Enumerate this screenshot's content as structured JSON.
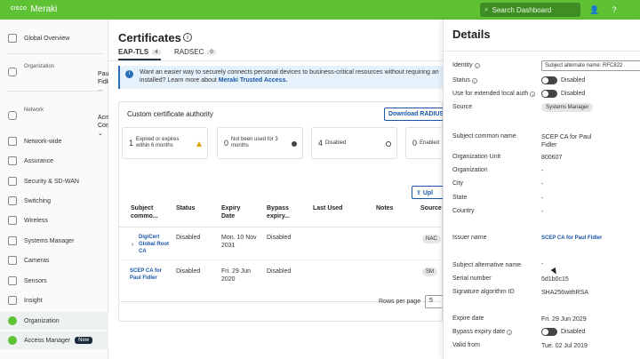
{
  "topbar": {
    "logo_company": "CISCO",
    "brand": "Meraki",
    "search_placeholder": "Search Dashboard",
    "icons": [
      "user-icon",
      "help-icon"
    ]
  },
  "sidebar": {
    "items": [
      {
        "label": "Global Overview",
        "icon": "globe-icon"
      },
      {
        "label": "Network-wide",
        "icon": "network-icon"
      },
      {
        "label": "Assurance",
        "icon": "assurance-icon"
      },
      {
        "label": "Security & SD-WAN",
        "icon": "shield-icon"
      },
      {
        "label": "Switching",
        "icon": "switch-icon"
      },
      {
        "label": "Wireless",
        "icon": "wifi-icon"
      },
      {
        "label": "Systems Manager",
        "icon": "device-icon"
      },
      {
        "label": "Cameras",
        "icon": "camera-icon"
      },
      {
        "label": "Sensors",
        "icon": "sensor-icon"
      },
      {
        "label": "Insight",
        "icon": "insight-icon"
      },
      {
        "label": "Organization",
        "icon": "organization-icon"
      },
      {
        "label": "Access Manager",
        "icon": "access-manager-icon",
        "badge": "New"
      }
    ],
    "organization": {
      "label": "Organization",
      "value": "Paul Fidler"
    },
    "network": {
      "label": "Network",
      "value": "Acme Corp"
    }
  },
  "main": {
    "title": "Certificates",
    "tabs": [
      {
        "label": "EAP-TLS",
        "count": "4"
      },
      {
        "label": "RADSEC",
        "count": "0"
      }
    ],
    "banner": {
      "text1": "Want an easier way to securely connects personal devices to business-critical resources without requiring an",
      "text2": "installed? Learn more about",
      "link": "Meraki Trusted Access."
    },
    "card_title": "Custom certificate authority",
    "download_button": "Download RADIUS",
    "upload_button": "Upl",
    "stats": [
      {
        "num": "1",
        "text": "Expired or expires within 6 months"
      },
      {
        "num": "0",
        "text": "Not been used for 3 months"
      },
      {
        "num": "4",
        "text": "Disabled"
      },
      {
        "num": "0",
        "text": "Enabled"
      }
    ],
    "table": {
      "headers": [
        "Subject commo...",
        "Status",
        "Expiry Date",
        "Bypass expiry...",
        "Last Used",
        "Notes",
        "Source"
      ],
      "rows": [
        {
          "subject": "DigiCert Global Root CA",
          "status": "Disabled",
          "expiry": "Mon. 10 Nov 2031",
          "bypass": "Disabled",
          "last_used": "",
          "notes": "",
          "source": "NAC"
        },
        {
          "subject": "SCEP CA for Paul Fidler",
          "status": "Disabled",
          "expiry": "Fri. 29 Jun 2020",
          "bypass": "Disabled",
          "last_used": "",
          "notes": "",
          "source": "SM"
        }
      ]
    },
    "rows_per_page_label": "Rows per page",
    "rows_per_page_value": "5"
  },
  "details": {
    "title": "Details",
    "identity_label": "Identity",
    "identity_value": "Subject alternate name: RFC822",
    "status_label": "Status",
    "status_value": "Disabled",
    "local_auth_label": "Use for extended local auth",
    "local_auth_value": "Disabled",
    "source_label": "Source",
    "source_value": "Systems Manager",
    "fields": [
      {
        "label": "Subject common name",
        "value": "SCEP CA for Paul Fidler"
      },
      {
        "label": "Organization Unit",
        "value": "800607"
      },
      {
        "label": "Organization",
        "value": "-"
      },
      {
        "label": "City",
        "value": "-"
      },
      {
        "label": "State",
        "value": "-"
      },
      {
        "label": "Country",
        "value": "-"
      }
    ],
    "issuer_label": "Issuer name",
    "issuer_value": "SCEP CA for Paul Fidler",
    "san_label": "Subject alternative name",
    "san_value": "-",
    "serial_label": "Serial number",
    "serial_value": "5d1b0c15",
    "sigalg_label": "Signature algorithm ID",
    "sigalg_value": "SHA256withRSA",
    "expiry_label": "Expire date",
    "expiry_value": "Fri. 29 Jun 2029",
    "bypass_label": "Bypass expiry date",
    "bypass_value": "Disabled",
    "valid_from_label": "Valid from",
    "valid_from_value": "Tue. 02 Jul 2019"
  }
}
